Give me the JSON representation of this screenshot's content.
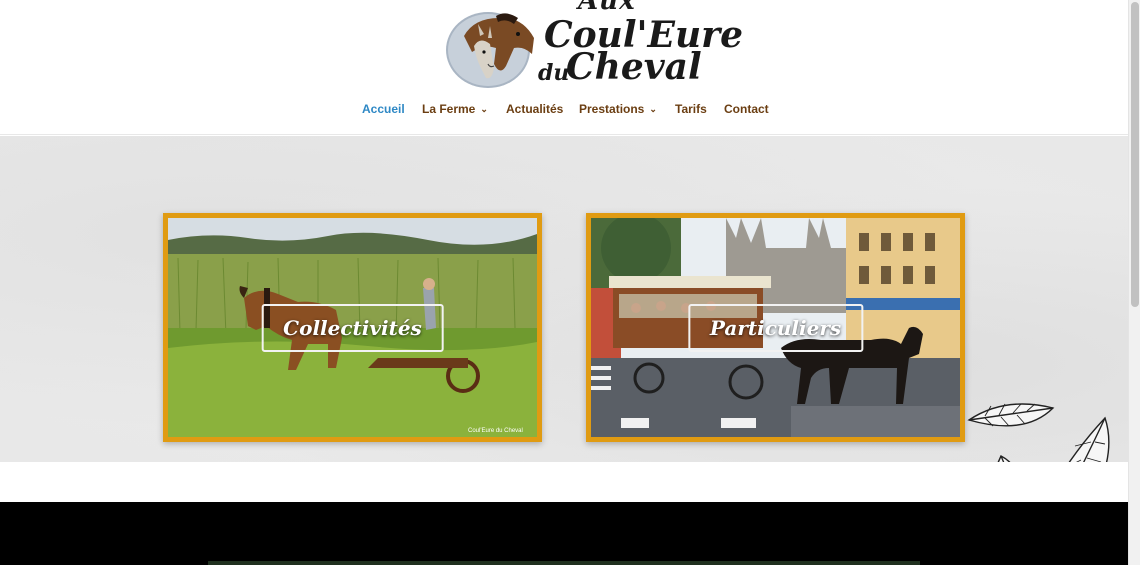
{
  "logo": {
    "line_aux": "Aux",
    "line1": "Coul'Eure",
    "line2_du": "du",
    "line2": "Cheval",
    "icon": "horse-donkey-emblem"
  },
  "nav": {
    "items": [
      {
        "label": "Accueil",
        "active": true,
        "has_dropdown": false
      },
      {
        "label": "La Ferme",
        "active": false,
        "has_dropdown": true
      },
      {
        "label": "Actualités",
        "active": false,
        "has_dropdown": false
      },
      {
        "label": "Prestations",
        "active": false,
        "has_dropdown": true
      },
      {
        "label": "Tarifs",
        "active": false,
        "has_dropdown": false
      },
      {
        "label": "Contact",
        "active": false,
        "has_dropdown": false
      }
    ],
    "dropdown_icon": "chevron-down-icon"
  },
  "cards": [
    {
      "label": "Collectivités",
      "image": "horse-mowing-field-photo",
      "watermark": "Coul'Eure du Cheval"
    },
    {
      "label": "Particuliers",
      "image": "horse-drawn-carriage-city-photo"
    }
  ],
  "decoration": {
    "icon": "leaves-sketch-icon"
  },
  "colors": {
    "accent_active": "#2e88c5",
    "nav_text": "#6b3e12",
    "card_border": "#e09b12",
    "dark_band": "#000000"
  }
}
